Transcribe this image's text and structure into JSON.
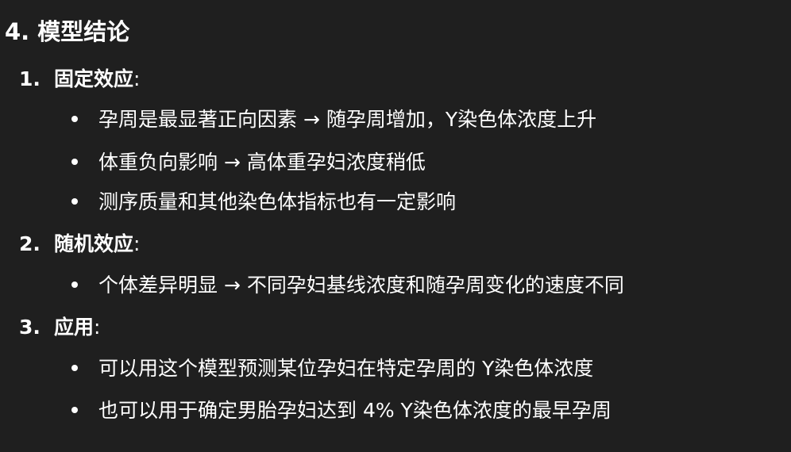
{
  "heading": "4. 模型结论",
  "sections": [
    {
      "number": "1.",
      "title": "固定效应",
      "colon": ":",
      "bullets": [
        "孕周是最显著正向因素 → 随孕周增加，Y染色体浓度上升",
        "体重负向影响 → 高体重孕妇浓度稍低",
        "测序质量和其他染色体指标也有一定影响"
      ]
    },
    {
      "number": "2.",
      "title": "随机效应",
      "colon": ":",
      "bullets": [
        "个体差异明显 → 不同孕妇基线浓度和随孕周变化的速度不同"
      ]
    },
    {
      "number": "3.",
      "title": "应用",
      "colon": ":",
      "bullets": [
        "可以用这个模型预测某位孕妇在特定孕周的 Y染色体浓度",
        "也可以用于确定男胎孕妇达到 4% Y染色体浓度的最早孕周"
      ]
    }
  ]
}
